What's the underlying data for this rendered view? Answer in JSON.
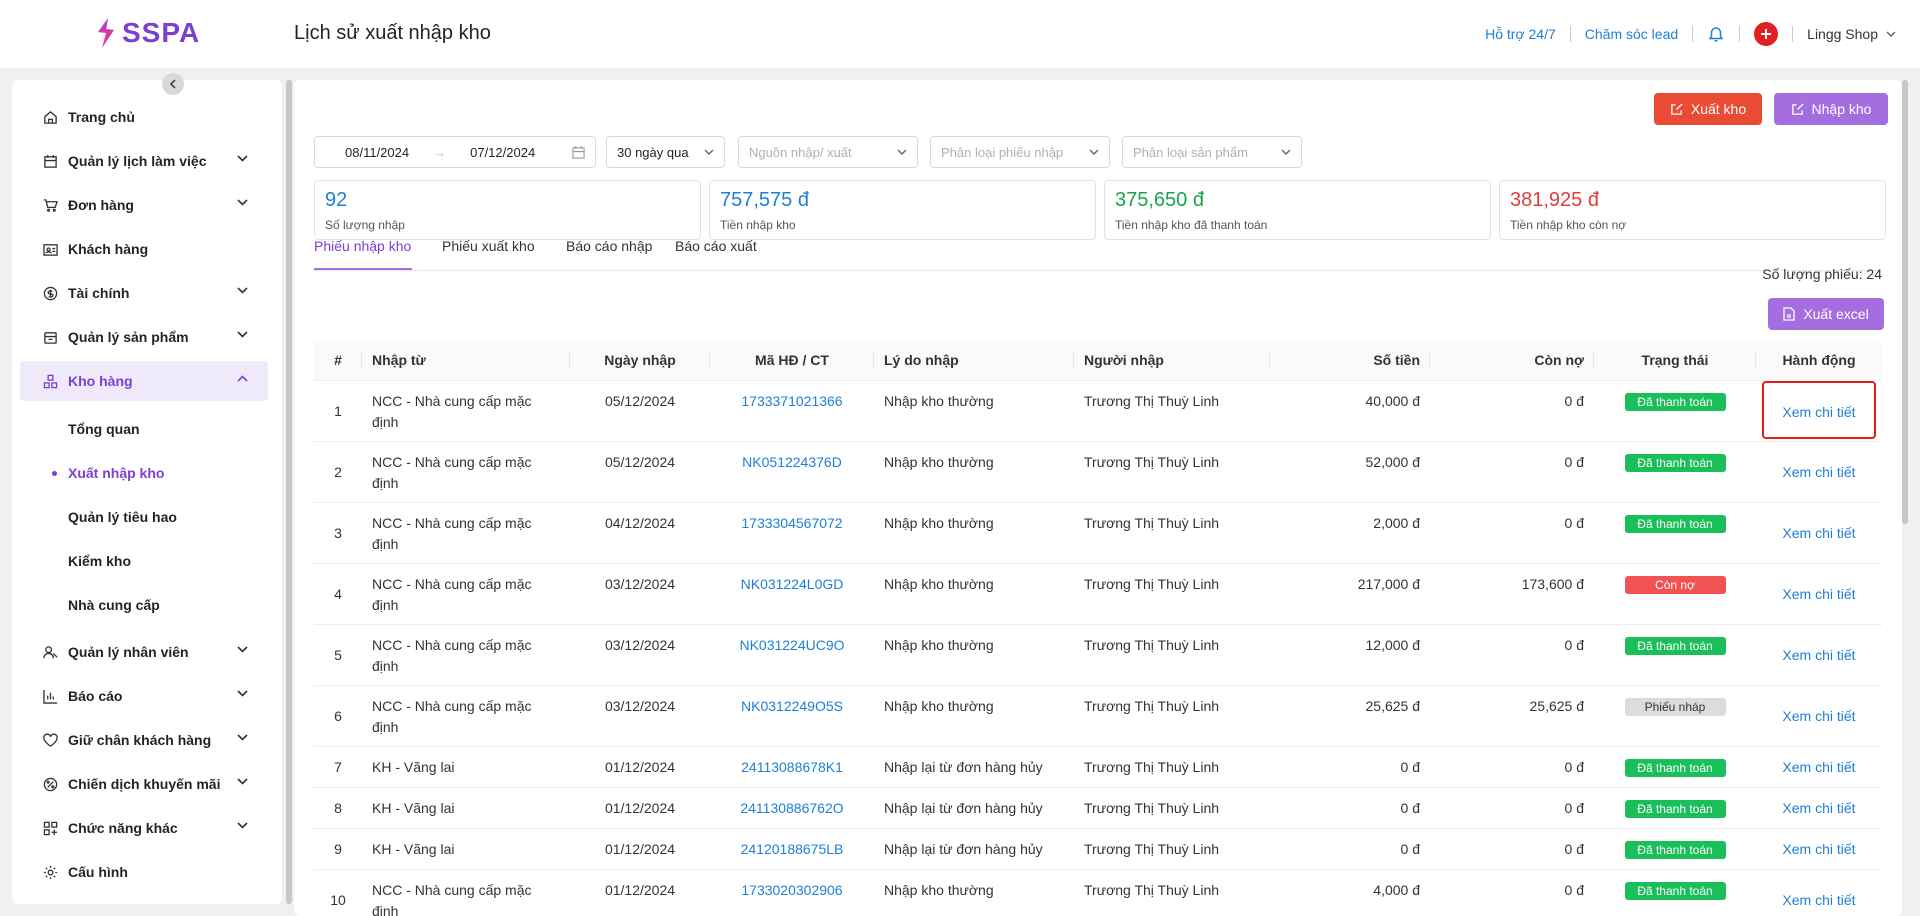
{
  "app": {
    "logo_text": "SSPA",
    "page_title": "Lịch sử xuất nhập kho"
  },
  "header": {
    "support": "Hỗ trợ 24/7",
    "lead_care": "Chăm sóc lead",
    "shop_name": "Lingg Shop"
  },
  "sidebar": {
    "items": [
      {
        "label": "Trang chủ",
        "icon": "home-icon"
      },
      {
        "label": "Quản lý lịch làm việc",
        "icon": "calendar-icon"
      },
      {
        "label": "Đơn hàng",
        "icon": "cart-icon"
      },
      {
        "label": "Khách hàng",
        "icon": "contact-card-icon"
      },
      {
        "label": "Tài chính",
        "icon": "dollar-icon"
      },
      {
        "label": "Quản lý sản phẩm",
        "icon": "box-icon"
      },
      {
        "label": "Kho hàng",
        "icon": "warehouse-icon"
      },
      {
        "label": "Quản lý nhân viên",
        "icon": "staff-icon"
      },
      {
        "label": "Báo cáo",
        "icon": "bar-chart-icon"
      },
      {
        "label": "Giữ chân khách hàng",
        "icon": "heart-icon"
      },
      {
        "label": "Chiến dịch khuyến mãi",
        "icon": "discount-icon"
      },
      {
        "label": "Chức năng khác",
        "icon": "grid-icon"
      },
      {
        "label": "Cấu hình",
        "icon": "gear-icon"
      }
    ],
    "sub_items": [
      "Tổng quan",
      "Xuất nhập kho",
      "Quản lý tiêu hao",
      "Kiểm kho",
      "Nhà cung cấp"
    ]
  },
  "actions": {
    "export_stock": "Xuất kho",
    "import_stock": "Nhập kho",
    "export_excel": "Xuất excel"
  },
  "filters": {
    "date_from": "08/11/2024",
    "date_to": "07/12/2024",
    "range": "30 ngày qua",
    "source_placeholder": "Nguồn nhập/ xuất",
    "receipt_type_placeholder": "Phân loại phiếu nhập",
    "product_type_placeholder": "Phân loại sản phẩm"
  },
  "stats": [
    {
      "value": "92",
      "label": "Số lượng nhập",
      "color": "#1e7fd8"
    },
    {
      "value": "757,575 đ",
      "label": "Tiền nhập kho",
      "color": "#1e7fd8"
    },
    {
      "value": "375,650 đ",
      "label": "Tiền nhập kho đã thanh toán",
      "color": "#1aa34a"
    },
    {
      "value": "381,925 đ",
      "label": "Tiền nhập kho còn nợ",
      "color": "#e03c3c"
    }
  ],
  "tabs": [
    "Phiếu nhập kho",
    "Phiếu xuất kho",
    "Báo cáo nhập",
    "Báo cáo xuất"
  ],
  "receipt_count": "Số lượng phiếu: 24",
  "table": {
    "headers": [
      "#",
      "Nhập từ",
      "Ngày nhập",
      "Mã HĐ / CT",
      "Lý do nhập",
      "Người nhập",
      "Số tiền",
      "Còn nợ",
      "Trạng thái",
      "Hành động"
    ],
    "rows": [
      {
        "no": "1",
        "source": "NCC - Nhà cung cấp mặc định",
        "date": "05/12/2024",
        "code": "1733371021366",
        "reason": "Nhập kho thường",
        "user": "Trương Thị Thuỳ Linh",
        "amount": "40,000 đ",
        "debt": "0 đ",
        "status": "Đã thanh toán",
        "action": "Xem chi tiết"
      },
      {
        "no": "2",
        "source": "NCC - Nhà cung cấp mặc định",
        "date": "05/12/2024",
        "code": "NK051224376D",
        "reason": "Nhập kho thường",
        "user": "Trương Thị Thuỳ Linh",
        "amount": "52,000 đ",
        "debt": "0 đ",
        "status": "Đã thanh toán",
        "action": "Xem chi tiết"
      },
      {
        "no": "3",
        "source": "NCC - Nhà cung cấp mặc định",
        "date": "04/12/2024",
        "code": "1733304567072",
        "reason": "Nhập kho thường",
        "user": "Trương Thị Thuỳ Linh",
        "amount": "2,000 đ",
        "debt": "0 đ",
        "status": "Đã thanh toán",
        "action": "Xem chi tiết"
      },
      {
        "no": "4",
        "source": "NCC - Nhà cung cấp mặc định",
        "date": "03/12/2024",
        "code": "NK031224L0GD",
        "reason": "Nhập kho thường",
        "user": "Trương Thị Thuỳ Linh",
        "amount": "217,000 đ",
        "debt": "173,600 đ",
        "status": "Còn nợ",
        "action": "Xem chi tiết"
      },
      {
        "no": "5",
        "source": "NCC - Nhà cung cấp mặc định",
        "date": "03/12/2024",
        "code": "NK031224UC9O",
        "reason": "Nhập kho thường",
        "user": "Trương Thị Thuỳ Linh",
        "amount": "12,000 đ",
        "debt": "0 đ",
        "status": "Đã thanh toán",
        "action": "Xem chi tiết"
      },
      {
        "no": "6",
        "source": "NCC - Nhà cung cấp mặc định",
        "date": "03/12/2024",
        "code": "NK0312249O5S",
        "reason": "Nhập kho thường",
        "user": "Trương Thị Thuỳ Linh",
        "amount": "25,625 đ",
        "debt": "25,625 đ",
        "status": "Phiếu nháp",
        "action": "Xem chi tiết"
      },
      {
        "no": "7",
        "source": "KH - Vãng lai",
        "date": "01/12/2024",
        "code": "24113088678K1",
        "reason": "Nhập lại từ đơn hàng hủy",
        "user": "Trương Thị Thuỳ Linh",
        "amount": "0 đ",
        "debt": "0 đ",
        "status": "Đã thanh toán",
        "action": "Xem chi tiết"
      },
      {
        "no": "8",
        "source": "KH - Vãng lai",
        "date": "01/12/2024",
        "code": "241130886762O",
        "reason": "Nhập lại từ đơn hàng hủy",
        "user": "Trương Thị Thuỳ Linh",
        "amount": "0 đ",
        "debt": "0 đ",
        "status": "Đã thanh toán",
        "action": "Xem chi tiết"
      },
      {
        "no": "9",
        "source": "KH - Vãng lai",
        "date": "01/12/2024",
        "code": "24120188675LB",
        "reason": "Nhập lại từ đơn hàng hủy",
        "user": "Trương Thị Thuỳ Linh",
        "amount": "0 đ",
        "debt": "0 đ",
        "status": "Đã thanh toán",
        "action": "Xem chi tiết"
      },
      {
        "no": "10",
        "source": "NCC - Nhà cung cấp mặc định",
        "date": "01/12/2024",
        "code": "1733020302906",
        "reason": "Nhập kho thường",
        "user": "Trương Thị Thuỳ Linh",
        "amount": "4,000 đ",
        "debt": "0 đ",
        "status": "Đã thanh toán",
        "action": "Xem chi tiết"
      }
    ]
  },
  "colors": {
    "brand": "#7b3fd4",
    "link": "#1e7fd8",
    "paid": "#1bbf5a",
    "debt": "#f25252",
    "draft": "#dcdcdc"
  }
}
